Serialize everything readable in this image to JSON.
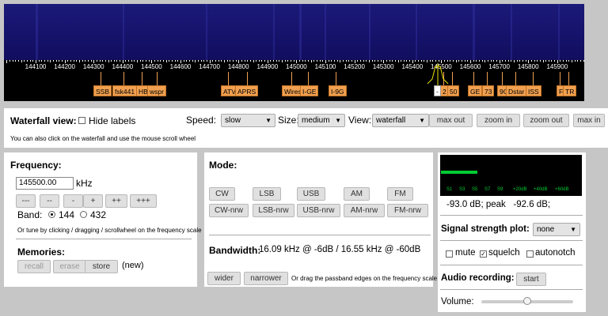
{
  "scale": {
    "ticks": [
      "144100",
      "144200",
      "144300",
      "144400",
      "144500",
      "144600",
      "144700",
      "144800",
      "144900",
      "145000",
      "145100",
      "145200",
      "145300",
      "145400",
      "145500",
      "145600",
      "145700",
      "145800",
      "145900"
    ],
    "labels": [
      "SSB",
      "fsk441",
      "HB",
      "wspr",
      "ATV",
      "APRS",
      "Wires",
      "I-GE",
      "I-9G",
      "2",
      "50",
      "GE",
      "73",
      "9G",
      "Dstar",
      "ISS",
      "F",
      "TR"
    ],
    "cursor_label": "-"
  },
  "waterfall": {
    "title": "Waterfall view:",
    "hide_labels": "Hide labels",
    "speed_label": "Speed:",
    "speed_value": "slow",
    "size_label": "Size:",
    "size_value": "medium",
    "view_label": "View:",
    "view_value": "waterfall",
    "buttons": [
      "max out",
      "zoom in",
      "zoom out",
      "max in"
    ],
    "hint": "You can also click on the waterfall and use the mouse scroll wheel"
  },
  "frequency": {
    "title": "Frequency:",
    "value": "145500.00",
    "unit": "kHz",
    "step_buttons": [
      "---",
      "--",
      "-",
      "+",
      "++",
      "+++"
    ],
    "band_label": "Band:",
    "band_options": [
      "144",
      "432"
    ],
    "band_selected": "144",
    "hint": "Or tune by clicking / dragging / scrollwheel on the frequency scale",
    "memories_title": "Memories:",
    "memory_buttons": [
      "recall",
      "erase",
      "store"
    ],
    "memory_new": "(new)"
  },
  "mode": {
    "title": "Mode:",
    "row1": [
      "CW",
      "LSB",
      "USB",
      "AM",
      "FM"
    ],
    "row2": [
      "CW-nrw",
      "LSB-nrw",
      "USB-nrw",
      "AM-nrw",
      "FM-nrw"
    ],
    "bandwidth_label": "Bandwidth:",
    "bandwidth_value": "16.09 kHz @ -6dB / 16.55 kHz @ -60dB",
    "wider": "wider",
    "narrower": "narrower",
    "hint": "Or drag the passband edges on the frequency scale"
  },
  "signal": {
    "meter_labels": [
      "S1",
      "S3",
      "S5",
      "S7",
      "S9",
      "+20dB",
      "+40dB",
      "+60dB"
    ],
    "level_fraction": 0.26,
    "readout": "-93.0 dB; peak   -92.6 dB;",
    "plot_label": "Signal strength plot:",
    "plot_value": "none",
    "mute": "mute",
    "squelch": "squelch",
    "autonotch": "autonotch",
    "audio_label": "Audio recording:",
    "start": "start",
    "volume_label": "Volume:",
    "volume_fraction": 0.5
  },
  "colors": {
    "label_bg": "#f0a050",
    "meter_green": "#00cc33",
    "waterfall": "#15126a"
  }
}
